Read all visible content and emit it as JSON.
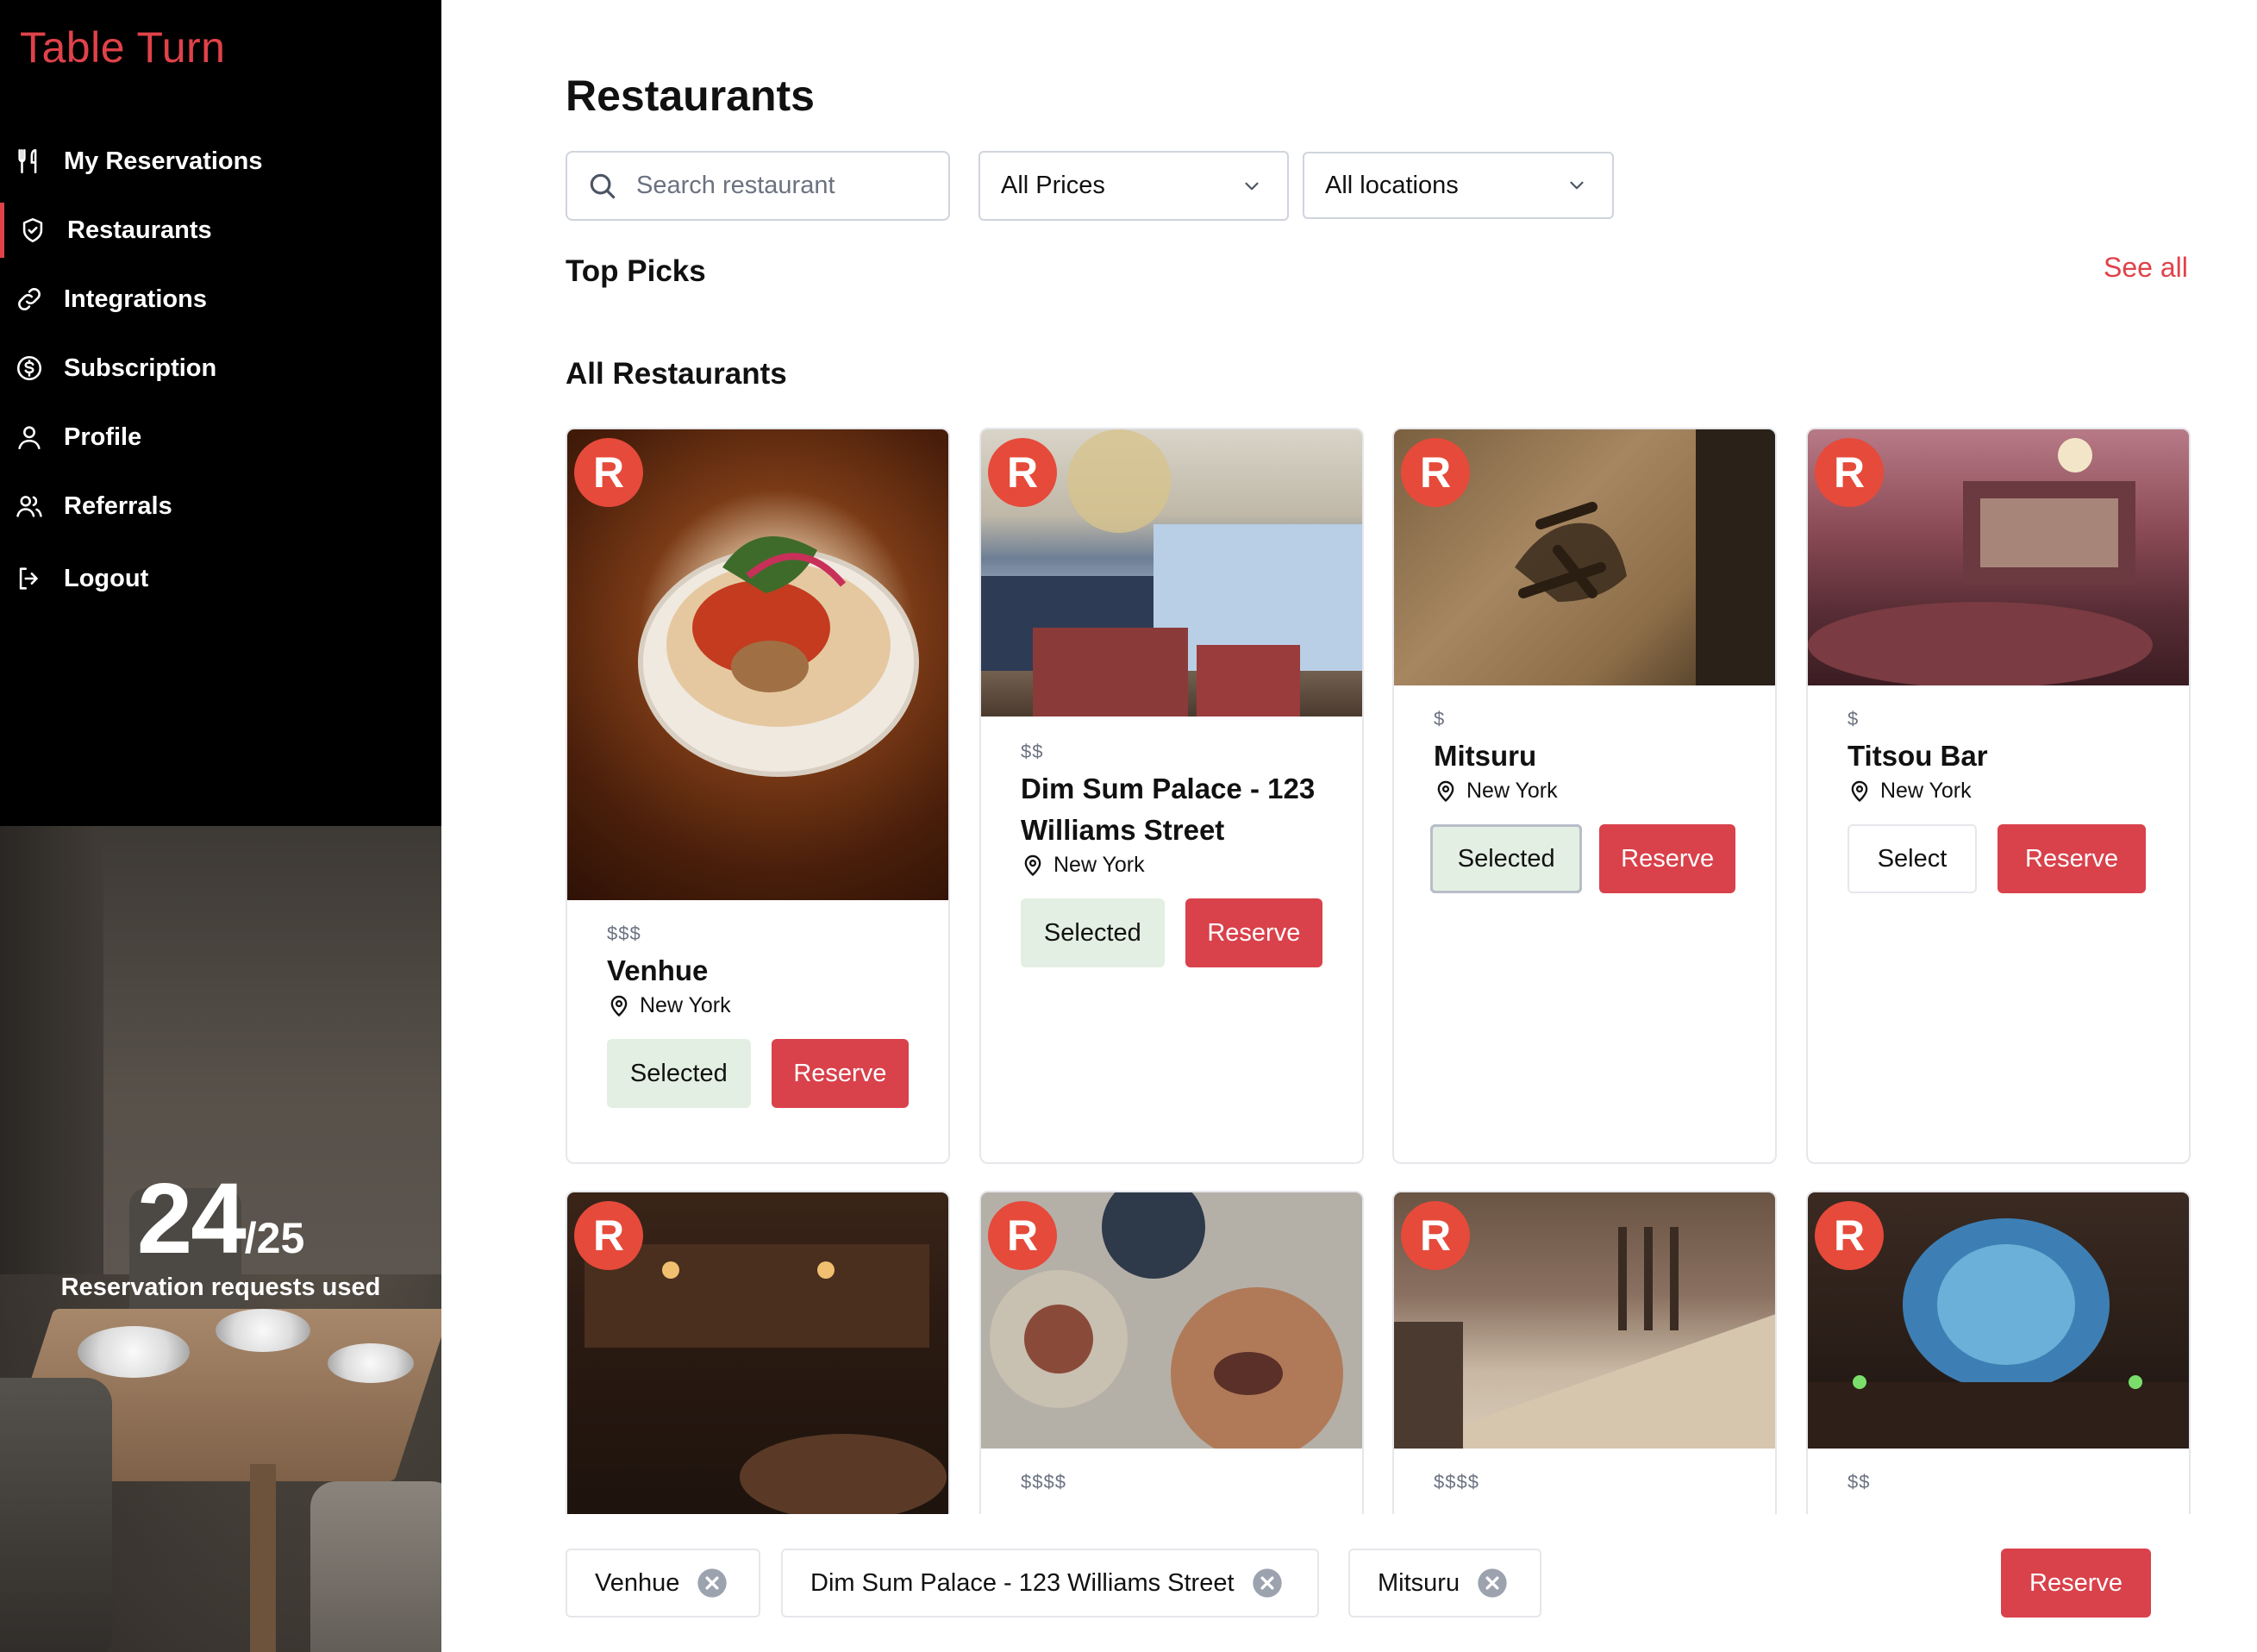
{
  "app": {
    "name": "Table Turn"
  },
  "colors": {
    "accent": "#e0424a",
    "selected_bg": "#e3efe2",
    "sidebar_bg": "#000000"
  },
  "sidebar": {
    "items": [
      {
        "label": "My Reservations",
        "icon": "utensils-icon"
      },
      {
        "label": "Restaurants",
        "icon": "shield-check-icon",
        "active": true
      },
      {
        "label": "Integrations",
        "icon": "link-icon"
      },
      {
        "label": "Subscription",
        "icon": "dollar-circle-icon"
      },
      {
        "label": "Profile",
        "icon": "user-icon"
      },
      {
        "label": "Referrals",
        "icon": "users-icon"
      },
      {
        "label": "Logout",
        "icon": "logout-icon"
      }
    ],
    "usage": {
      "used": "24",
      "total": "/25",
      "label": "Reservation requests used"
    }
  },
  "main": {
    "title": "Restaurants",
    "search": {
      "placeholder": "Search restaurant",
      "value": ""
    },
    "price_filter": {
      "selected": "All Prices"
    },
    "location_filter": {
      "selected": "All locations"
    },
    "top_picks": {
      "title": "Top Picks",
      "see_all": "See all"
    },
    "all_restaurants": {
      "title": "All Restaurants"
    },
    "badge_letter": "R",
    "cards": [
      {
        "price": "$$$",
        "name": "Venhue",
        "location": "New York",
        "state": "Selected",
        "reserve": "Reserve"
      },
      {
        "price": "$$",
        "name": "Dim Sum Palace - 123 Williams Street",
        "location": "New York",
        "state": "Selected",
        "reserve": "Reserve"
      },
      {
        "price": "$",
        "name": "Mitsuru",
        "location": "New York",
        "state": "Selected",
        "reserve": "Reserve"
      },
      {
        "price": "$",
        "name": "Titsou Bar",
        "location": "New York",
        "state": "Select",
        "reserve": "Reserve"
      },
      {
        "price": "",
        "name": "",
        "location": "",
        "state": "",
        "reserve": ""
      },
      {
        "price": "$$$$",
        "name": "",
        "location": "",
        "state": "",
        "reserve": ""
      },
      {
        "price": "$$$$",
        "name": "",
        "location": "",
        "state": "",
        "reserve": ""
      },
      {
        "price": "$$",
        "name": "",
        "location": "",
        "state": "",
        "reserve": ""
      }
    ]
  },
  "selection_bar": {
    "chips": [
      "Venhue",
      "Dim Sum Palace - 123 Williams Street",
      "Mitsuru"
    ],
    "reserve": "Reserve"
  }
}
